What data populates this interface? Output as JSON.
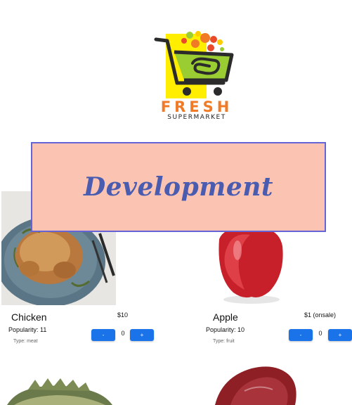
{
  "brand": {
    "word": "FRESH",
    "sub": "SUPERMARKET",
    "colors": {
      "orange": "#f07a26",
      "lime": "#9acd32",
      "yellow": "#ffee00",
      "dark": "#2b2b2b"
    }
  },
  "products": [
    {
      "name": "Chicken",
      "price": "$10",
      "popularity": "Popularity: 11",
      "type": "Type: meat",
      "quantity": "0",
      "decrement_label": "-",
      "increment_label": "+"
    },
    {
      "name": "Apple",
      "price": "$1 (onsale)",
      "popularity": "Popularity: 10",
      "type": "Type: fruit",
      "quantity": "0",
      "decrement_label": "-",
      "increment_label": "+"
    }
  ],
  "overlay": {
    "label": "Development",
    "background": "#fbc4b2",
    "border": "#6464d6",
    "text_color": "#4a5cb0"
  },
  "button_color": "#1a73e8"
}
